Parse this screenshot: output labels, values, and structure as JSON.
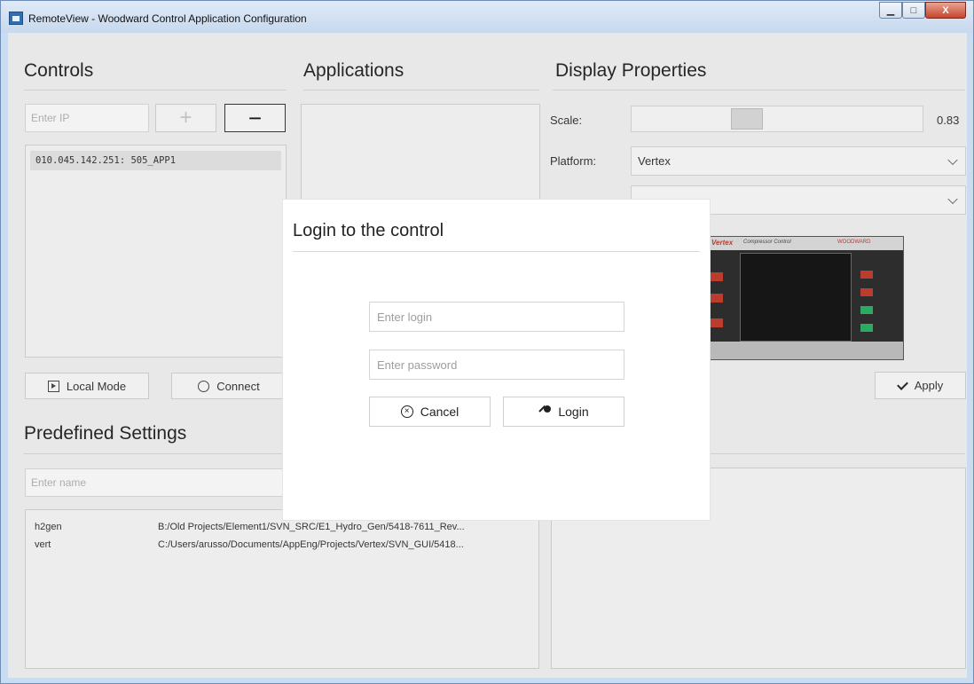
{
  "window": {
    "title": "RemoteView - Woodward Control Application Configuration",
    "minimize_glyph": "▁",
    "maximize_glyph": "□",
    "close_glyph": "X"
  },
  "controls": {
    "title": "Controls",
    "ip_placeholder": "Enter IP",
    "add_label": "+",
    "remove_label": "−",
    "list": [
      "010.045.142.251:  505_APP1"
    ],
    "local_mode_label": "Local Mode",
    "connect_label": "Connect"
  },
  "applications": {
    "title": "Applications"
  },
  "display_properties": {
    "title": "Display  Properties",
    "scale_label": "Scale:",
    "scale_value": "0.83",
    "platform_label": "Platform:",
    "platform_value": "Vertex",
    "second_select_value": "",
    "apply_label": "Apply",
    "device_brand": "Vertex",
    "device_subtitle": "Compressor Control",
    "device_maker": "WOODWARD"
  },
  "predefined_settings": {
    "title": "Predefined  Settings",
    "name_placeholder": "Enter name",
    "rows": [
      {
        "name": "h2gen",
        "path": "B:/Old  Projects/Element1/SVN_SRC/E1_Hydro_Gen/5418-7611_Rev..."
      },
      {
        "name": "vert",
        "path": "C:/Users/arusso/Documents/AppEng/Projects/Vertex/SVN_GUI/5418..."
      }
    ]
  },
  "login_dialog": {
    "title": "Login  to  the  control",
    "login_placeholder": "Enter  login",
    "password_placeholder": "Enter  password",
    "cancel_label": "Cancel",
    "login_label": "Login"
  },
  "colors": {
    "window_bg": "#efefef",
    "dialog_bg": "#ffffff",
    "close_button": "#c7452e"
  }
}
